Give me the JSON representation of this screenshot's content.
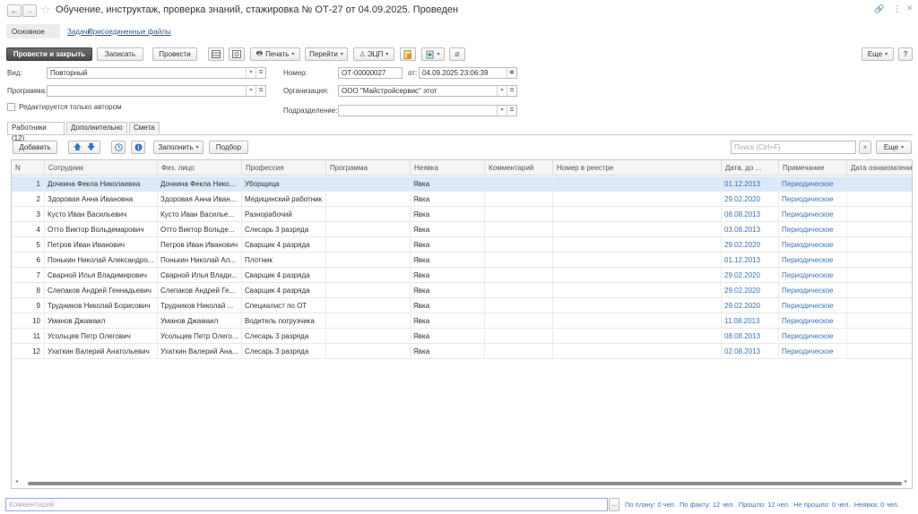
{
  "window": {
    "title": "Обучение, инструктаж, проверка знаний, стажировка № ОТ-27 от 04.09.2025. Проведен",
    "controls": {
      "link": "🔗",
      "more": "⋮",
      "close": "×"
    }
  },
  "nav": {
    "back": "←",
    "forward": "→",
    "star": "☆",
    "tabs": [
      "Основное",
      "Задачи",
      "Присоединенные файлы"
    ]
  },
  "toolbar": {
    "post_close": "Провести и закрыть",
    "save": "Записать",
    "post": "Провести",
    "print": "Печать",
    "goto": "Перейти",
    "ecp": "ЭЦП",
    "more": "Еще",
    "help": "?"
  },
  "form": {
    "vid_label": "Вид:",
    "vid_value": "Повторный",
    "program_label": "Программа:",
    "program_value": "",
    "author_only_label": "Редактируется только автором",
    "number_label": "Номер:",
    "number_value": "ОТ-00000027",
    "date_label": "от:",
    "date_value": "04.09.2025 23:06:39",
    "org_label": "Организация:",
    "org_value": "ООО \"Майстройсервис\" этот",
    "dept_label": "Подразделение:",
    "dept_value": ""
  },
  "tabs": [
    "Работники (12)",
    "Дополнительно",
    "Смета"
  ],
  "table_toolbar": {
    "add": "Добавить",
    "fill": "Заполнить",
    "select": "Подбор",
    "search_placeholder": "Поиск (Ctrl+F)",
    "clear": "×",
    "more": "Еще"
  },
  "table": {
    "columns": [
      "N",
      "Сотрудник",
      "Физ. лицо",
      "Профессия",
      "Программа",
      "Неявка",
      "Комментарий",
      "Номер в реестре",
      "Дата, до ...",
      "Примечание",
      "Дата ознакомлени"
    ],
    "rows": [
      {
        "n": "1",
        "employee": "Дочкина Фекла Николаевна",
        "person": "Дочкина Фекла Нико...",
        "profession": "Уборщица",
        "program": "",
        "absence": "Явка",
        "comment": "",
        "registry": "",
        "date": "01.12.2013",
        "note": "Периодическое",
        "ack": ""
      },
      {
        "n": "2",
        "employee": "Здоровая Анна Ивановна",
        "person": "Здоровая Анна Иван...",
        "profession": "Медицинский работник",
        "program": "",
        "absence": "Явка",
        "comment": "",
        "registry": "",
        "date": "29.02.2020",
        "note": "Периодическое",
        "ack": ""
      },
      {
        "n": "3",
        "employee": "Кусто Иван Васильевич",
        "person": "Кусто Иван Василье...",
        "profession": "Разнорабочий",
        "program": "",
        "absence": "Явка",
        "comment": "",
        "registry": "",
        "date": "08.08.2013",
        "note": "Периодическое",
        "ack": ""
      },
      {
        "n": "4",
        "employee": "Отто Виктор Вольдемарович",
        "person": "Отто Виктор Вольде...",
        "profession": "Слесарь 3 разряда",
        "program": "",
        "absence": "Явка",
        "comment": "",
        "registry": "",
        "date": "03.08.2013",
        "note": "Периодическое",
        "ack": ""
      },
      {
        "n": "5",
        "employee": "Петров Иван Иванович",
        "person": "Петров Иван Иванович",
        "profession": "Сварщик 4 разряда",
        "program": "",
        "absence": "Явка",
        "comment": "",
        "registry": "",
        "date": "29.02.2020",
        "note": "Периодическое",
        "ack": ""
      },
      {
        "n": "6",
        "employee": "Понькин Николай Александро...",
        "person": "Понькин Николай Ал...",
        "profession": "Плотник",
        "program": "",
        "absence": "Явка",
        "comment": "",
        "registry": "",
        "date": "01.12.2013",
        "note": "Периодическое",
        "ack": ""
      },
      {
        "n": "7",
        "employee": "Сварной Илья Владимирович",
        "person": "Сварной Илья Влади...",
        "profession": "Сварщик 4 разряда",
        "program": "",
        "absence": "Явка",
        "comment": "",
        "registry": "",
        "date": "29.02.2020",
        "note": "Периодическое",
        "ack": ""
      },
      {
        "n": "8",
        "employee": "Слепаков Андрей Геннадьевич",
        "person": "Слепаков Андрей Ге...",
        "profession": "Сварщик 4 разряда",
        "program": "",
        "absence": "Явка",
        "comment": "",
        "registry": "",
        "date": "29.02.2020",
        "note": "Периодическое",
        "ack": ""
      },
      {
        "n": "9",
        "employee": "Трудников Николай Борисович",
        "person": "Трудников Николай ...",
        "profession": "Специалист по ОТ",
        "program": "",
        "absence": "Явка",
        "comment": "",
        "registry": "",
        "date": "29.02.2020",
        "note": "Периодическое",
        "ack": ""
      },
      {
        "n": "10",
        "employee": "Уманов Джамаил",
        "person": "Уманов Джамаил",
        "profession": "Водитель погрузчика",
        "program": "",
        "absence": "Явка",
        "comment": "",
        "registry": "",
        "date": "11.08.2013",
        "note": "Периодическое",
        "ack": ""
      },
      {
        "n": "11",
        "employee": "Усольцев Петр Олегович",
        "person": "Усольцев Петр Олего...",
        "profession": "Слесарь 3 разряда",
        "program": "",
        "absence": "Явка",
        "comment": "",
        "registry": "",
        "date": "08.08.2013",
        "note": "Периодическое",
        "ack": ""
      },
      {
        "n": "12",
        "employee": "Ухаткин Валерий Анатольевич",
        "person": "Ухаткин Валерий Ана...",
        "profession": "Слесарь 3 разряда",
        "program": "",
        "absence": "Явка",
        "comment": "",
        "registry": "",
        "date": "02.08.2013",
        "note": "Периодическое",
        "ack": ""
      }
    ]
  },
  "footer": {
    "comment_placeholder": "Комментарий",
    "comment_btn": "...",
    "summary": "По плану: 0 чел.  По факту: 12 чел.  Прошло: 12 чел.  Не прошло: 0 чел.  Неявка: 0 чел."
  },
  "colors": {
    "accent": "#2a59a8",
    "selected_row": "#dbe8f7",
    "link_blue": "#3b74b8",
    "primary_btn": "#555555"
  }
}
